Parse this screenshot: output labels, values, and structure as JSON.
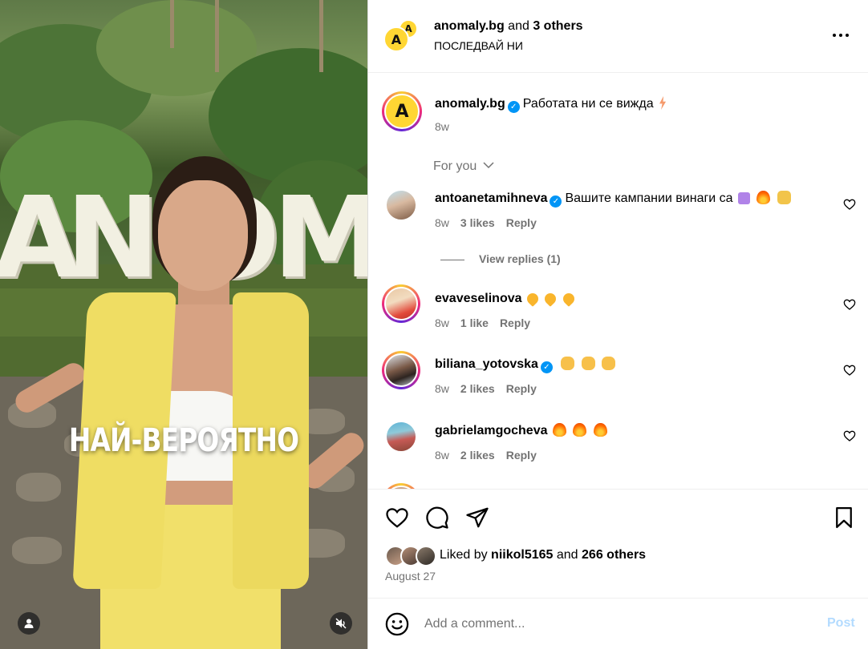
{
  "media": {
    "overlay_caption": "НАЙ-ВЕРОЯТНО",
    "sign_letters": [
      "A",
      "N",
      "O",
      "M"
    ]
  },
  "header": {
    "username": "anomaly.bg",
    "joiner": "and",
    "others": "3 others",
    "subtitle": "ПОСЛЕДВАЙ НИ",
    "logo_letter": "A"
  },
  "caption": {
    "username": "anomaly.bg",
    "text": "Работата ни се вижда",
    "time": "8w"
  },
  "filter": {
    "label": "For you"
  },
  "comments": [
    {
      "username": "antoanetamihneva",
      "verified": true,
      "text": "Вашите кампании винаги са",
      "emojis": [
        "top",
        "fire",
        "hands"
      ],
      "time": "8w",
      "likes": "3 likes",
      "reply": "Reply",
      "view_replies": "View replies (1)"
    },
    {
      "username": "evaveselinova",
      "verified": false,
      "text": "",
      "emojis": [
        "heart",
        "heart",
        "heart"
      ],
      "time": "8w",
      "likes": "1 like",
      "reply": "Reply"
    },
    {
      "username": "biliana_yotovska",
      "verified": true,
      "text": "",
      "emojis": [
        "clap",
        "clap",
        "clap"
      ],
      "time": "8w",
      "likes": "2 likes",
      "reply": "Reply"
    },
    {
      "username": "gabrielamgocheva",
      "verified": false,
      "text": "",
      "emojis": [
        "fire",
        "fire",
        "fire"
      ],
      "time": "8w",
      "likes": "2 likes",
      "reply": "Reply"
    }
  ],
  "likes": {
    "prefix": "Liked by",
    "first_user": "niikol5165",
    "joiner": "and",
    "others": "266 others",
    "date": "August 27"
  },
  "add_comment": {
    "placeholder": "Add a comment...",
    "post_label": "Post"
  },
  "colors": {
    "brand_yellow": "#ffd633",
    "link_blue": "#0095f6",
    "post_disabled": "#b3dbff",
    "muted_text": "#737373"
  },
  "icons": [
    "more-icon",
    "verified-badge-icon",
    "chevron-down-icon",
    "heart-icon",
    "comment-icon",
    "share-icon",
    "bookmark-icon",
    "smiley-icon",
    "user-icon",
    "mute-icon"
  ]
}
